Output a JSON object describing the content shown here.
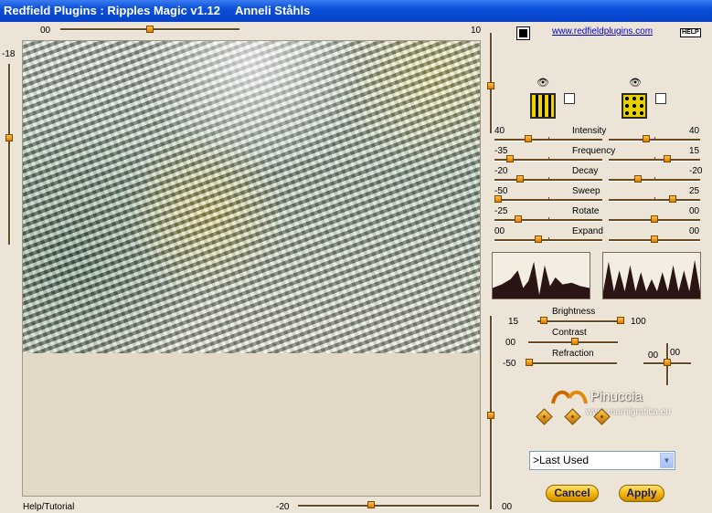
{
  "window": {
    "title": "Redfield Plugins : Ripples Magic v1.12",
    "author_stamp": "Anneli Ståhls"
  },
  "top_slider": {
    "value_left": "00",
    "value_right": "10"
  },
  "left_slider": {
    "value": "-18"
  },
  "link": {
    "text": "www.redfieldplugins.com"
  },
  "help_label": "HELP",
  "sliders": [
    {
      "label": "Intensity",
      "left_value": "40",
      "right_value": "40",
      "left_pos": 0.3,
      "right_pos": 0.4
    },
    {
      "label": "Frequency",
      "left_value": "-35",
      "right_value": "15",
      "left_pos": 0.12,
      "right_pos": 0.65
    },
    {
      "label": "Decay",
      "left_value": "-20",
      "right_value": "-20",
      "left_pos": 0.22,
      "right_pos": 0.3
    },
    {
      "label": "Sweep",
      "left_value": "-50",
      "right_value": "25",
      "left_pos": 0.0,
      "right_pos": 0.72
    },
    {
      "label": "Rotate",
      "left_value": "-25",
      "right_value": "00",
      "left_pos": 0.2,
      "right_pos": 0.5
    },
    {
      "label": "Expand",
      "left_value": "00",
      "right_value": "00",
      "left_pos": 0.4,
      "right_pos": 0.5
    }
  ],
  "brightness": {
    "label": "Brightness",
    "left_value": "15",
    "right_value": "100",
    "left_pos": 0.0,
    "right_pos": 1.0
  },
  "contrast": {
    "label": "Contrast",
    "value": "00",
    "pos": 0.4
  },
  "refraction": {
    "label": "Refraction",
    "value": "-50",
    "pos": 0.0
  },
  "refraction_xy": {
    "x": "00",
    "y": "00"
  },
  "logo": {
    "name": "Pinuccia",
    "url": "www.marnigrafica.eu"
  },
  "preset": {
    "selected": ">Last Used"
  },
  "buttons": {
    "cancel": "Cancel",
    "apply": "Apply"
  },
  "bottom": {
    "help_tutorial": "Help/Tutorial",
    "bottom_left_value": "-20",
    "bottom_right_value": "00"
  },
  "colors": {
    "accent": "#f0a000",
    "titlebar": "#0a4fd8",
    "background": "#ece4d6"
  }
}
